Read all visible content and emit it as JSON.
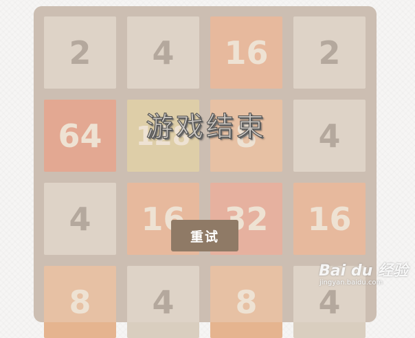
{
  "game": {
    "overlay_text": "游戏结束",
    "retry_label": "重试"
  },
  "grid": [
    [
      {
        "value": "2",
        "bg": "#d9cebf",
        "color": "#9e9285"
      },
      {
        "value": "4",
        "bg": "#d9cebf",
        "color": "#9e9285"
      },
      {
        "value": "16",
        "bg": "#e5aa86",
        "color": "#efe2d0"
      },
      {
        "value": "2",
        "bg": "#d9cebf",
        "color": "#9e9285"
      }
    ],
    [
      {
        "value": "64",
        "bg": "#df9276",
        "color": "#efe2d0"
      },
      {
        "value": "128",
        "bg": "#d9c795",
        "color": "#efe2d0"
      },
      {
        "value": "8",
        "bg": "#e5b48f",
        "color": "#efe2d0"
      },
      {
        "value": "4",
        "bg": "#d9cebf",
        "color": "#9e9285"
      }
    ],
    [
      {
        "value": "4",
        "bg": "#d9cebf",
        "color": "#9e9285"
      },
      {
        "value": "16",
        "bg": "#e5aa86",
        "color": "#efe2d0"
      },
      {
        "value": "32",
        "bg": "#e39f88",
        "color": "#efe2d0"
      },
      {
        "value": "16",
        "bg": "#e5aa86",
        "color": "#efe2d0"
      }
    ],
    [
      {
        "value": "8",
        "bg": "#e5b48f",
        "color": "#efe2d0"
      },
      {
        "value": "4",
        "bg": "#d9cebf",
        "color": "#9e9285"
      },
      {
        "value": "8",
        "bg": "#e5b48f",
        "color": "#efe2d0"
      },
      {
        "value": "4",
        "bg": "#d9cebf",
        "color": "#9e9285"
      }
    ]
  ],
  "watermark": {
    "logo": "Bai du 经验",
    "url": "jingyan.baidu.com"
  }
}
